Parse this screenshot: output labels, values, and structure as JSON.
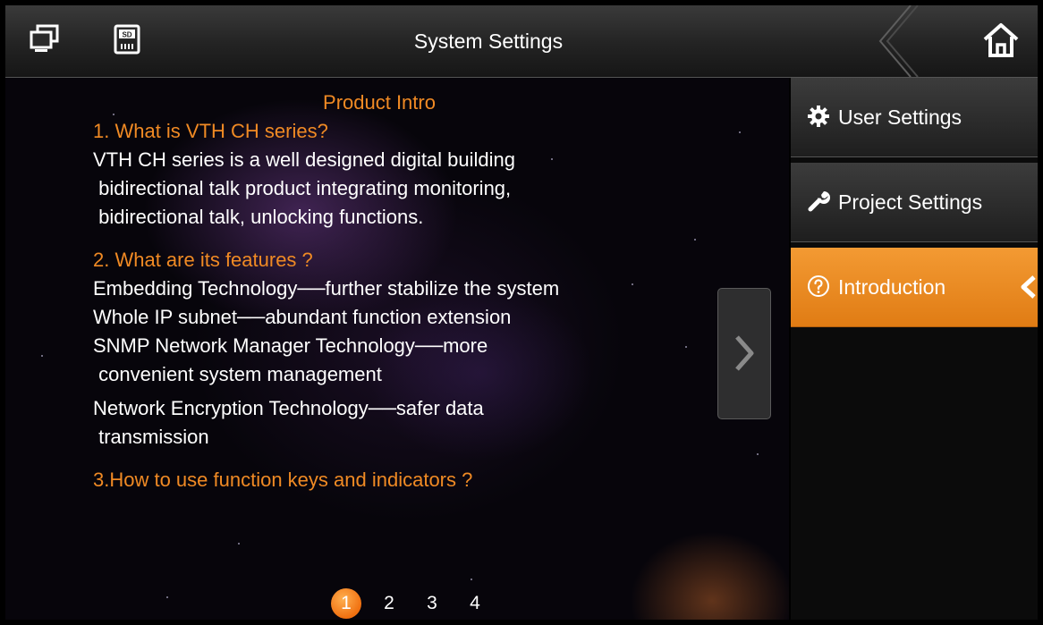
{
  "header": {
    "title": "System Settings",
    "left_icons": [
      "monitor-icon",
      "sd-card-icon"
    ],
    "home_icon": "home-icon"
  },
  "content": {
    "heading": "Product Intro",
    "q1": "1. What is VTH CH series?",
    "a1_line1": "VTH CH series is a well designed digital building",
    "a1_line2": " bidirectional talk product integrating monitoring,",
    "a1_line3": " bidirectional talk, unlocking functions.",
    "q2": "2. What are its features ?",
    "f1": "Embedding Technology──further stabilize the system",
    "f2": "Whole IP subnet──abundant function extension",
    "f3_line1": "SNMP Network Manager Technology──more",
    "f3_line2": " convenient system management",
    "f4_line1": "Network Encryption Technology──safer data",
    "f4_line2": " transmission",
    "q3": "3.How to use function keys and indicators ?",
    "next_icon": "chevron-right-icon"
  },
  "pager": {
    "pages": [
      "1",
      "2",
      "3",
      "4"
    ],
    "current": "1"
  },
  "sidebar": {
    "items": [
      {
        "label": "User Settings",
        "icon": "gear-icon"
      },
      {
        "label": "Project Settings",
        "icon": "wrench-icon"
      },
      {
        "label": "Introduction",
        "icon": "question-icon",
        "active": true
      }
    ]
  },
  "colors": {
    "accent": "#f08a24",
    "active_tab": "#e98a22"
  }
}
